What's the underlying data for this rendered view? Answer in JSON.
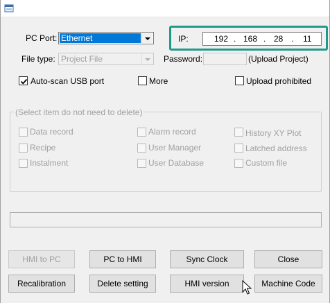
{
  "icons": {
    "app": "app-window-icon",
    "cursor": "mouse-pointer-icon"
  },
  "colors": {
    "highlight": "#0078d7",
    "ip_frame": "#1f9a8a"
  },
  "connection": {
    "pc_port_label": "PC Port:",
    "pc_port_value": "Ethernet",
    "file_type_label": "File type:",
    "file_type_value": "Project File",
    "ip_label": "IP:",
    "ip": [
      "192",
      "168",
      "28",
      "11"
    ],
    "ip_sep": ".",
    "password_label": "Password:",
    "upload_project_label": "(Upload Project)"
  },
  "options": {
    "auto_scan": {
      "label": "Auto-scan USB port",
      "checked": true
    },
    "more": {
      "label": "More",
      "checked": false
    },
    "upload_prohibited": {
      "label": "Upload prohibited",
      "checked": false
    }
  },
  "delete_group": {
    "title": "(Select item do not need to delete)",
    "items": [
      "Data record",
      "Alarm record",
      "History XY Plot",
      "Recipe",
      "User Manager",
      "Latched address",
      "Instalment",
      "User Database",
      "Custom file"
    ]
  },
  "buttons": {
    "hmi_to_pc": "HMI to PC",
    "pc_to_hmi": "PC to HMI",
    "sync_clock": "Sync Clock",
    "close": "Close",
    "recalibration": "Recalibration",
    "delete_setting": "Delete setting",
    "hmi_version": "HMI version",
    "machine_code": "Machine Code"
  }
}
